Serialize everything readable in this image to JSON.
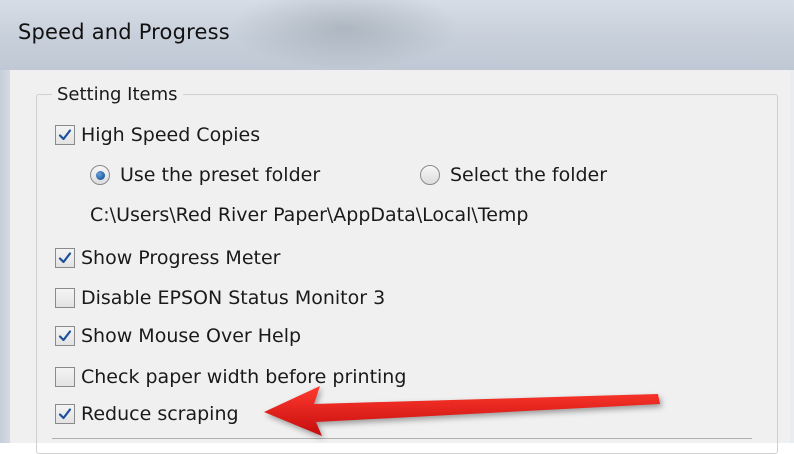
{
  "dialog": {
    "title": "Speed and Progress"
  },
  "group": {
    "label": "Setting Items"
  },
  "high_speed_copies": {
    "label": "High Speed Copies",
    "checked": true
  },
  "folder_options": [
    {
      "label": "Use the preset folder",
      "selected": true
    },
    {
      "label": "Select the folder",
      "selected": false
    }
  ],
  "folder_path": "C:\\Users\\Red River Paper\\AppData\\Local\\Temp",
  "options": [
    {
      "label": "Show Progress Meter",
      "checked": true
    },
    {
      "label": "Disable EPSON Status Monitor 3",
      "checked": false
    },
    {
      "label": "Show Mouse Over Help",
      "checked": true
    },
    {
      "label": "Check paper width before printing",
      "checked": false
    },
    {
      "label": "Reduce scraping",
      "checked": true
    }
  ],
  "colors": {
    "check_mark": "#1c4f9c",
    "radio_dot": "#1f5fa8",
    "arrow": "#e01515"
  },
  "annotation": {
    "type": "red-arrow",
    "points_to": "Reduce scraping"
  }
}
